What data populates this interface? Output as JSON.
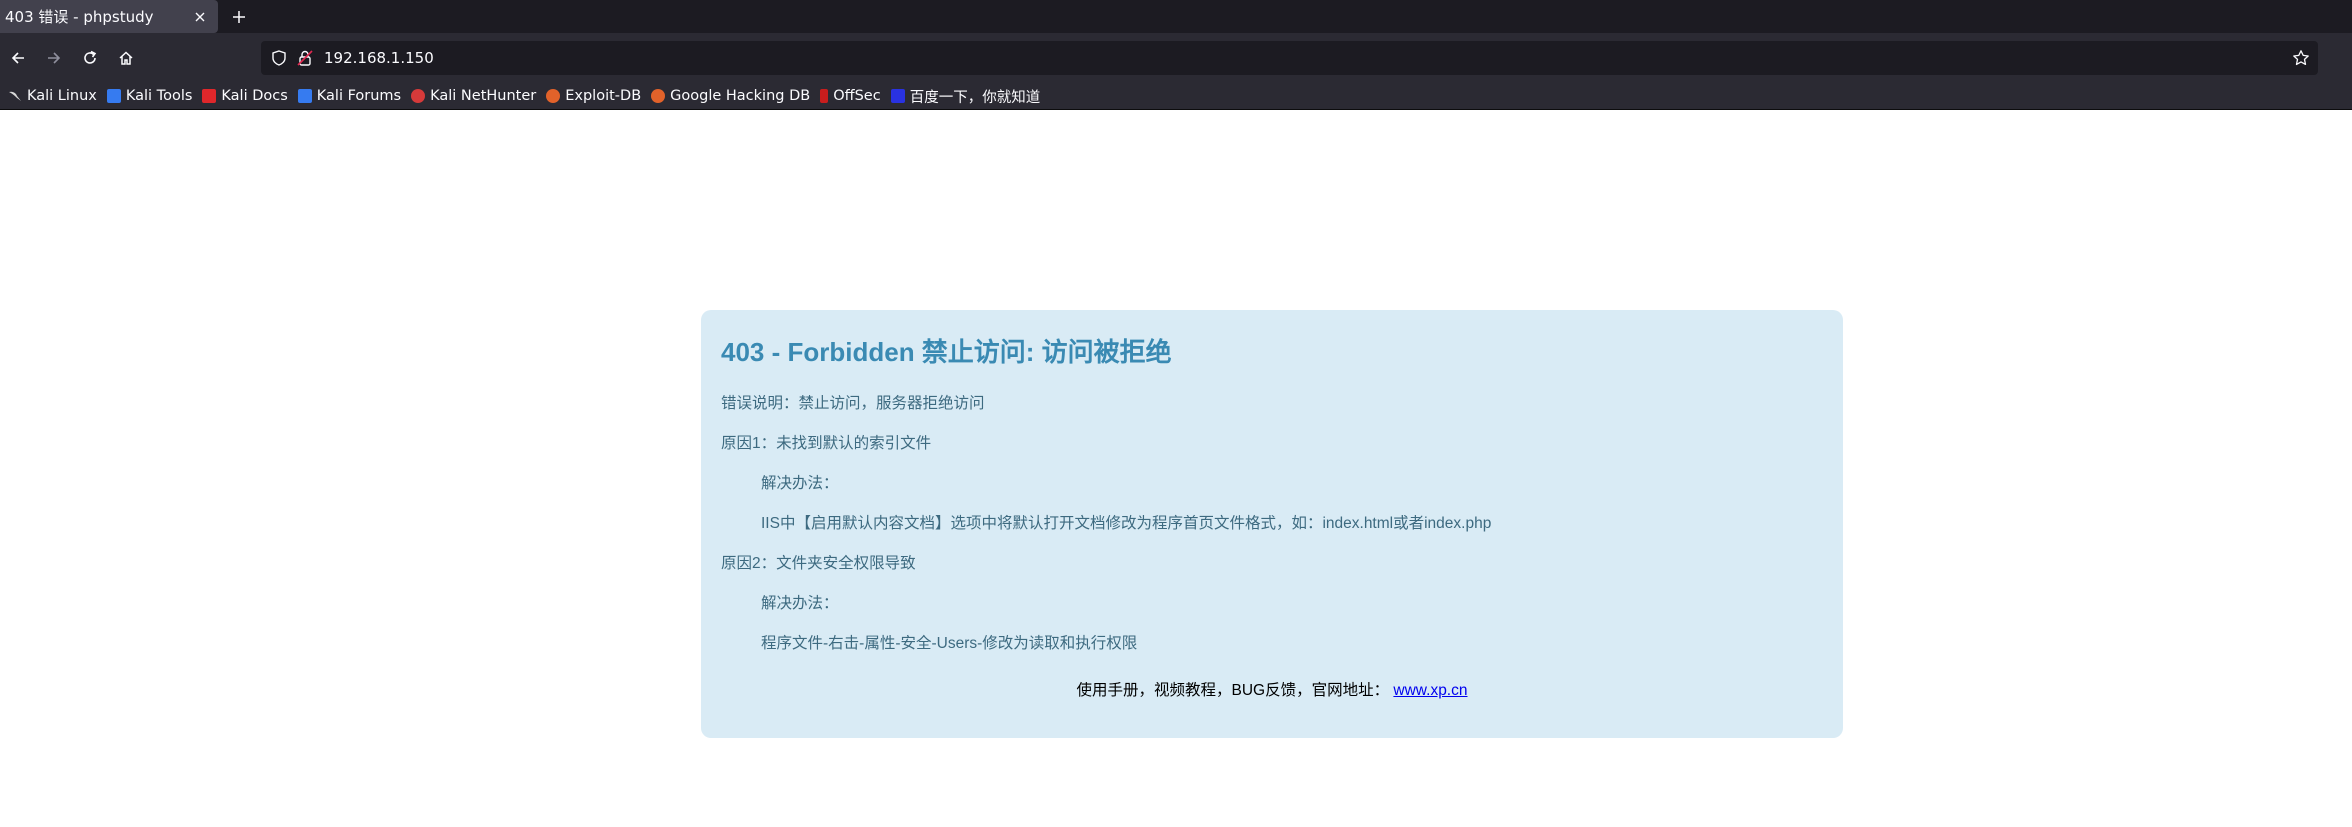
{
  "browser": {
    "tab": {
      "title": "403 错误 - phpstudy",
      "close_icon": "close-icon"
    },
    "new_tab_icon": "plus-icon",
    "nav": {
      "back_icon": "arrow-left-icon",
      "forward_icon": "arrow-right-icon",
      "reload_icon": "reload-icon",
      "home_icon": "home-icon",
      "url": "192.168.1.150",
      "shield_icon": "shield-icon",
      "insecure_icon": "insecure-lock-icon",
      "bookmark_star_icon": "star-icon"
    },
    "bookmarks": [
      {
        "label": "Kali Linux",
        "icon": "kali-dragon-icon",
        "color": "#1f1f1f"
      },
      {
        "label": "Kali Tools",
        "icon": "kali-tools-icon",
        "color": "#367bf0"
      },
      {
        "label": "Kali Docs",
        "icon": "kali-docs-icon",
        "color": "#e0272b"
      },
      {
        "label": "Kali Forums",
        "icon": "kali-forums-icon",
        "color": "#367bf0"
      },
      {
        "label": "Kali NetHunter",
        "icon": "nethunter-icon",
        "color": "#d63a3a"
      },
      {
        "label": "Exploit-DB",
        "icon": "exploitdb-icon",
        "color": "#e2622a"
      },
      {
        "label": "Google Hacking DB",
        "icon": "ghdb-icon",
        "color": "#e2622a"
      },
      {
        "label": "OffSec",
        "icon": "offsec-icon",
        "color": "#c81d1d"
      },
      {
        "label": "百度一下，你就知道",
        "icon": "baidu-icon",
        "color": "#2932e1"
      }
    ]
  },
  "page": {
    "title": "403 - Forbidden 禁止访问: 访问被拒绝",
    "description": "错误说明：禁止访问，服务器拒绝访问",
    "reason1": "原因1：未找到默认的索引文件",
    "solution_label_1": "解决办法：",
    "solution1": "IIS中【启用默认内容文档】选项中将默认打开文档修改为程序首页文件格式，如：index.html或者index.php",
    "reason2": "原因2：文件夹安全权限导致",
    "solution_label_2": "解决办法：",
    "solution2": "程序文件-右击-属性-安全-Users-修改为读取和执行权限",
    "footer_text": "使用手册，视频教程，BUG反馈，官网地址：",
    "footer_link": "www.xp.cn"
  },
  "colors": {
    "panel_bg": "#d9ebf5",
    "title": "#3a8ab3",
    "body_text": "#3d6a80",
    "link": "#0000ee"
  }
}
